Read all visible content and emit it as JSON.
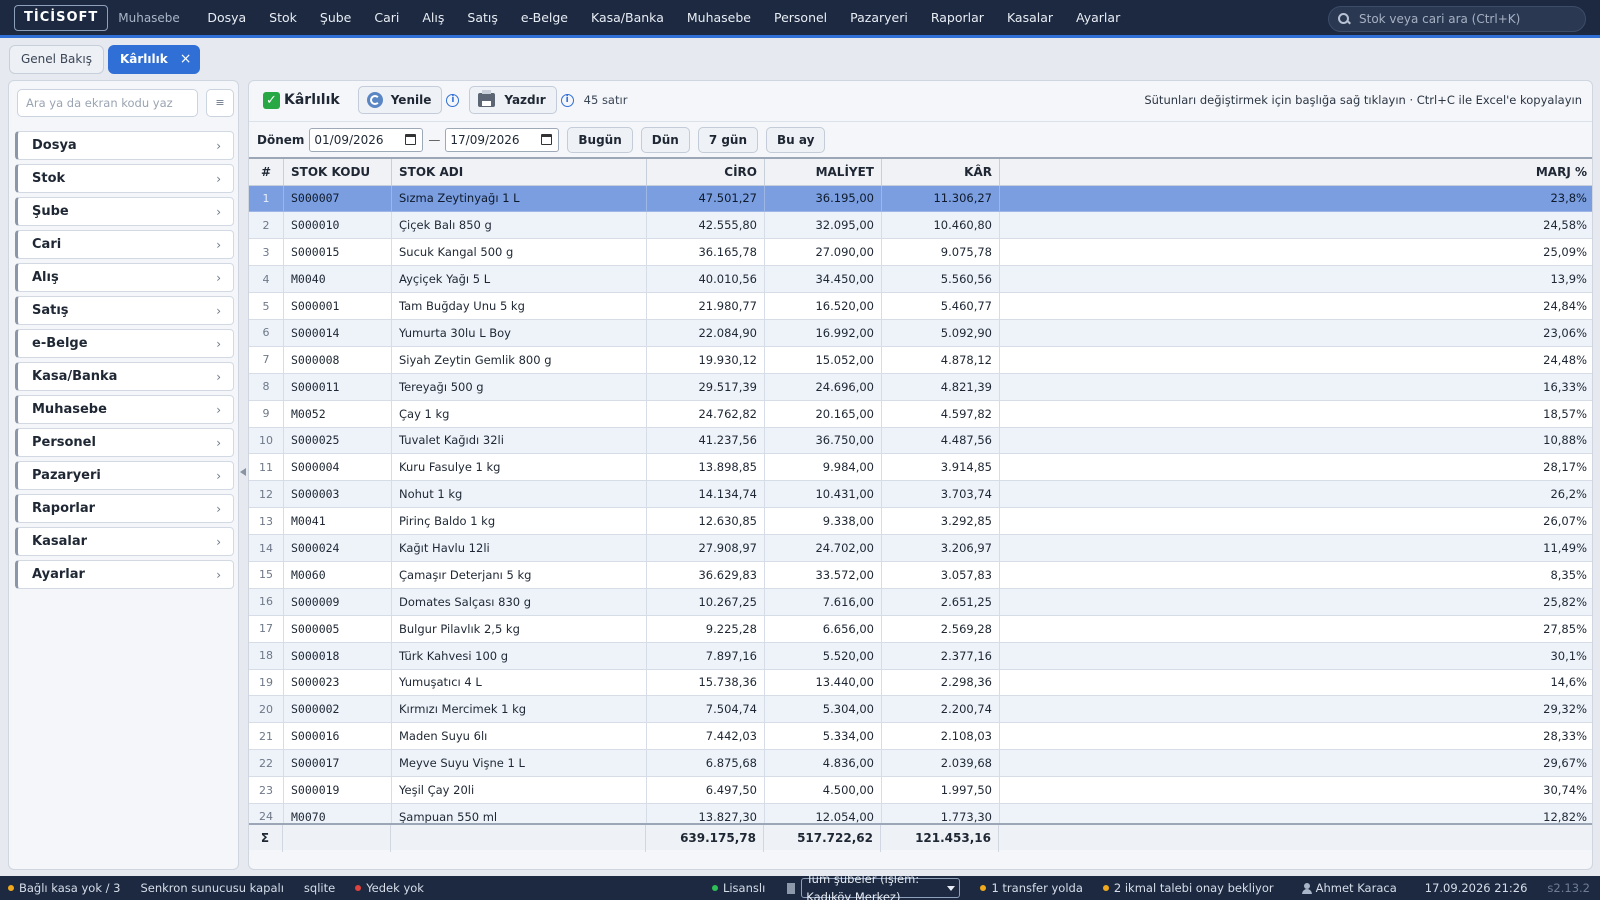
{
  "app": {
    "logo": "TİCİSOFT",
    "module": "Muhasebe"
  },
  "menu": [
    "Dosya",
    "Stok",
    "Şube",
    "Cari",
    "Alış",
    "Satış",
    "e-Belge",
    "Kasa/Banka",
    "Muhasebe",
    "Personel",
    "Pazaryeri",
    "Raporlar",
    "Kasalar",
    "Ayarlar"
  ],
  "search": {
    "placeholder": "Stok veya cari ara (Ctrl+K)"
  },
  "tabs": [
    {
      "label": "Genel Bakış",
      "active": false
    },
    {
      "label": "Kârlılık",
      "active": true,
      "close": "×"
    }
  ],
  "sidebar": {
    "search_placeholder": "Ara ya da ekran kodu yaz",
    "menu_button": "≡",
    "items": [
      "Dosya",
      "Stok",
      "Şube",
      "Cari",
      "Alış",
      "Satış",
      "e-Belge",
      "Kasa/Banka",
      "Muhasebe",
      "Personel",
      "Pazaryeri",
      "Raporlar",
      "Kasalar",
      "Ayarlar"
    ]
  },
  "toolbar": {
    "title": "Kârlılık",
    "refresh_label": "Yenile",
    "print_label": "Yazdır",
    "row_count": "45 satır",
    "hint": "Sütunları değiştirmek için başlığa sağ tıklayın · Ctrl+C ile Excel'e kopyalayın"
  },
  "period": {
    "label": "Dönem",
    "start": "01/09/2026",
    "end": "17/09/2026",
    "separator": "—",
    "buttons": [
      "Bugün",
      "Dün",
      "7 gün",
      "Bu ay"
    ]
  },
  "table": {
    "columns": [
      "#",
      "STOK KODU",
      "STOK ADI",
      "CİRO",
      "MALİYET",
      "KÂR",
      "MARJ %"
    ],
    "selected_row": 0,
    "rows": [
      [
        "1",
        "S000007",
        "Sızma Zeytinyağı 1 L",
        "47.501,27",
        "36.195,00",
        "11.306,27",
        "23,8%"
      ],
      [
        "2",
        "S000010",
        "Çiçek Balı 850 g",
        "42.555,80",
        "32.095,00",
        "10.460,80",
        "24,58%"
      ],
      [
        "3",
        "S000015",
        "Sucuk Kangal 500 g",
        "36.165,78",
        "27.090,00",
        "9.075,78",
        "25,09%"
      ],
      [
        "4",
        "M0040",
        "Ayçiçek Yağı 5 L",
        "40.010,56",
        "34.450,00",
        "5.560,56",
        "13,9%"
      ],
      [
        "5",
        "S000001",
        "Tam Buğday Unu 5 kg",
        "21.980,77",
        "16.520,00",
        "5.460,77",
        "24,84%"
      ],
      [
        "6",
        "S000014",
        "Yumurta 30lu L Boy",
        "22.084,90",
        "16.992,00",
        "5.092,90",
        "23,06%"
      ],
      [
        "7",
        "S000008",
        "Siyah Zeytin Gemlik 800 g",
        "19.930,12",
        "15.052,00",
        "4.878,12",
        "24,48%"
      ],
      [
        "8",
        "S000011",
        "Tereyağı 500 g",
        "29.517,39",
        "24.696,00",
        "4.821,39",
        "16,33%"
      ],
      [
        "9",
        "M0052",
        "Çay 1 kg",
        "24.762,82",
        "20.165,00",
        "4.597,82",
        "18,57%"
      ],
      [
        "10",
        "S000025",
        "Tuvalet Kağıdı 32li",
        "41.237,56",
        "36.750,00",
        "4.487,56",
        "10,88%"
      ],
      [
        "11",
        "S000004",
        "Kuru Fasulye 1 kg",
        "13.898,85",
        "9.984,00",
        "3.914,85",
        "28,17%"
      ],
      [
        "12",
        "S000003",
        "Nohut 1 kg",
        "14.134,74",
        "10.431,00",
        "3.703,74",
        "26,2%"
      ],
      [
        "13",
        "M0041",
        "Pirinç Baldo 1 kg",
        "12.630,85",
        "9.338,00",
        "3.292,85",
        "26,07%"
      ],
      [
        "14",
        "S000024",
        "Kağıt Havlu 12li",
        "27.908,97",
        "24.702,00",
        "3.206,97",
        "11,49%"
      ],
      [
        "15",
        "M0060",
        "Çamaşır Deterjanı 5 kg",
        "36.629,83",
        "33.572,00",
        "3.057,83",
        "8,35%"
      ],
      [
        "16",
        "S000009",
        "Domates Salçası 830 g",
        "10.267,25",
        "7.616,00",
        "2.651,25",
        "25,82%"
      ],
      [
        "17",
        "S000005",
        "Bulgur Pilavlık 2,5 kg",
        "9.225,28",
        "6.656,00",
        "2.569,28",
        "27,85%"
      ],
      [
        "18",
        "S000018",
        "Türk Kahvesi 100 g",
        "7.897,16",
        "5.520,00",
        "2.377,16",
        "30,1%"
      ],
      [
        "19",
        "S000023",
        "Yumuşatıcı 4 L",
        "15.738,36",
        "13.440,00",
        "2.298,36",
        "14,6%"
      ],
      [
        "20",
        "S000002",
        "Kırmızı Mercimek 1 kg",
        "7.504,74",
        "5.304,00",
        "2.200,74",
        "29,32%"
      ],
      [
        "21",
        "S000016",
        "Maden Suyu 6lı",
        "7.442,03",
        "5.334,00",
        "2.108,03",
        "28,33%"
      ],
      [
        "22",
        "S000017",
        "Meyve Suyu Vişne 1 L",
        "6.875,68",
        "4.836,00",
        "2.039,68",
        "29,67%"
      ],
      [
        "23",
        "S000019",
        "Yeşil Çay 20li",
        "6.497,50",
        "4.500,00",
        "1.997,50",
        "30,74%"
      ],
      [
        "24",
        "M0070",
        "Şampuan 550 ml",
        "13.827,30",
        "12.054,00",
        "1.773,30",
        "12,82%"
      ]
    ],
    "totals": {
      "symbol": "Σ",
      "ciro": "639.175,78",
      "maliyet": "517.722,62",
      "kar": "121.453,16"
    }
  },
  "status": {
    "kasa": "Bağlı kasa yok / 3",
    "sync": "Senkron sunucusu kapalı",
    "db": "sqlite",
    "backup": "Yedek yok",
    "license": "Lisanslı",
    "branch": "Tüm şubeler (işlem: Kadıköy Merkez)",
    "transfer": "1 transfer yolda",
    "ikmal": "2 ikmal talebi onay bekliyor",
    "user": "Ahmet Karaca",
    "datetime": "17.09.2026 21:26",
    "version": "s2.13.2"
  },
  "colors": {
    "accent": "#2f6fd6",
    "topbar": "#1c2940",
    "selected_row": "#7a9ee0"
  },
  "icons": {
    "search": "search-icon",
    "refresh": "refresh-icon",
    "print": "printer-icon",
    "info": "info-icon",
    "calendar": "calendar-icon",
    "user": "user-icon"
  }
}
